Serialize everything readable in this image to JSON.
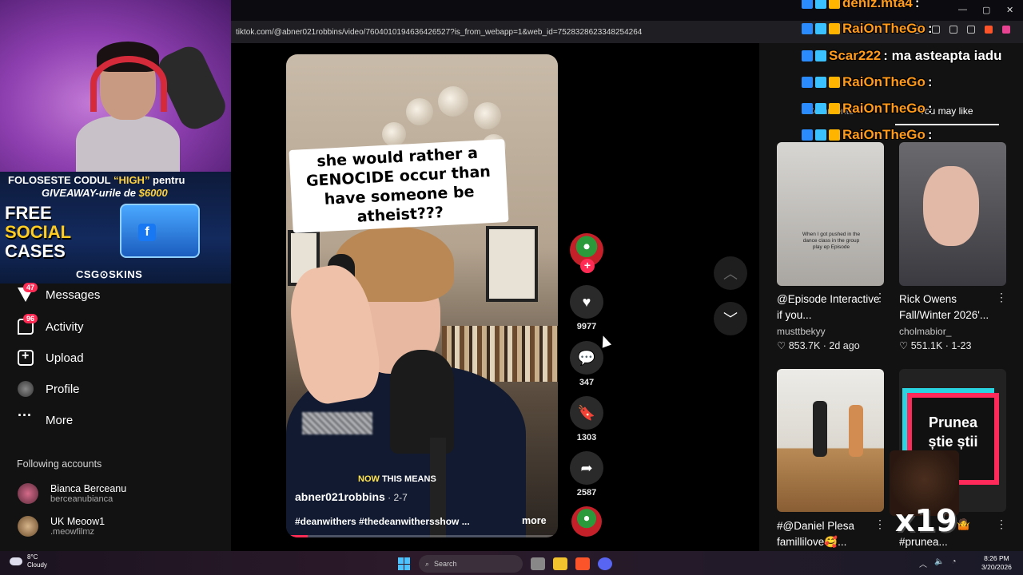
{
  "browser": {
    "url": "tiktok.com/@abner021robbins/video/7604010194636426527?is_from_webapp=1&web_id=7528328623348254264"
  },
  "stream_overlay": {
    "promo_line1_a": "FOLOSESTE CODUL ",
    "promo_code": "“HIGH”",
    "promo_line1_b": " pentru",
    "promo_line2_a": "GIVEAWAY-urile de ",
    "promo_amount": "$6000",
    "ad_free": "FREE",
    "ad_social": "SOCIAL",
    "ad_cases": "CASES",
    "ad_brand": "CSG⊙SKINS",
    "ad_fb": "f",
    "gift_multiplier": "x19"
  },
  "sidebar": {
    "items": [
      {
        "label": "Messages",
        "badge": "47",
        "icon": "messages-icon"
      },
      {
        "label": "Activity",
        "badge": "96",
        "icon": "activity-icon"
      },
      {
        "label": "Upload",
        "icon": "upload-icon"
      },
      {
        "label": "Profile",
        "icon": "profile-icon"
      },
      {
        "label": "More",
        "icon": "more-icon"
      }
    ],
    "following_title": "Following accounts",
    "following": [
      {
        "name": "Bianca Berceanu",
        "handle": "berceanubianca"
      },
      {
        "name": "UK Meoow1",
        "handle": ".meowfilmz"
      }
    ]
  },
  "video": {
    "caption": "she would rather a GENOCIDE occur than have someone be atheist???",
    "subtitle_now": "NOW",
    "subtitle_rest": " THIS MEANS",
    "author": "abner021robbins",
    "date": " · 2-7",
    "tags": "#deanwithers #thedeanwithersshow ...",
    "more": "more",
    "progress": 0.08,
    "likes": "9977",
    "comments": "347",
    "saves": "1303",
    "shares": "2587"
  },
  "chat": [
    {
      "user": "deniz.mta4",
      "msg": " :"
    },
    {
      "user": "RaiOnTheGo",
      "msg": " :"
    },
    {
      "user": "Scar222",
      "msg": " : ma asteapta iadu"
    },
    {
      "user": "RaiOnTheGo",
      "msg": " :"
    },
    {
      "user": "RaiOnTheGo",
      "msg": " :"
    },
    {
      "user": "RaiOnTheGo",
      "msg": " :"
    }
  ],
  "right_panel": {
    "tab_comments": "Comments",
    "tab_you_may_like": "You may like",
    "cards": [
      {
        "title": "@Episode Interactive if you...",
        "author": "musttbekyy",
        "likes": "853.7K",
        "date": "2d ago",
        "thumb_text": "When I got pushed in the dance class in the group play ep Episode"
      },
      {
        "title": "Rick Owens Fall/Winter 2026'...",
        "author": "cholmabior_",
        "likes": "551.1K",
        "date": "1-23"
      },
      {
        "title": "#@Daniel Plesa famillilove🥰...",
        "author": "",
        "likes": "",
        "date": ""
      },
      {
        "title": "#prunea...",
        "author": "",
        "likes": "",
        "date": "",
        "thumb_text": "Prunea știe știi",
        "title_line1": "e 🤷"
      }
    ]
  },
  "taskbar": {
    "temp": "8°C",
    "weather": "Cloudy",
    "search": "Search",
    "time": "8:26 PM",
    "date": "3/20/2026"
  }
}
